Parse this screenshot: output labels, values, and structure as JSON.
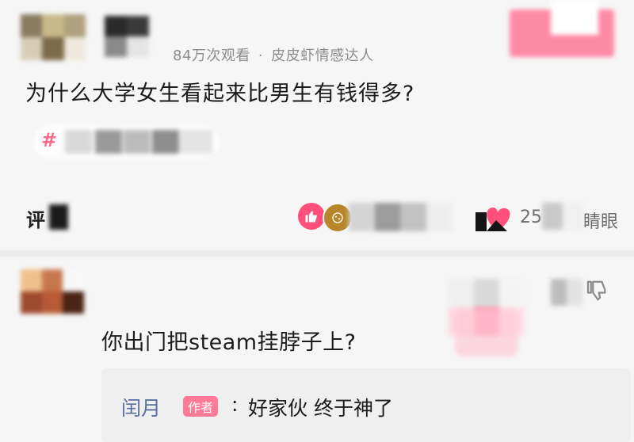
{
  "post": {
    "views": "84万次观看",
    "separator": "·",
    "category": "皮皮虾情感达人",
    "question": "为什么大学女生看起来比男生有钱得多?",
    "topic_hash": "#"
  },
  "action_bar": {
    "comment_label": "评",
    "like_count": "1",
    "fav_count": "25",
    "fav_suffix": "睛眼"
  },
  "comment": {
    "text": "你出门把steam挂脖子上?",
    "reply": {
      "name": "闰月",
      "badge": "作者",
      "colon": ":",
      "text": "好家伙 终于神了"
    }
  },
  "icons": {
    "like": "thumb-up-icon",
    "coin": "coin-icon",
    "heart": "heart-icon",
    "dislike": "thumb-down-icon"
  },
  "colors": {
    "accent_pink": "#ff4f7b",
    "badge_pink": "#ff7a96",
    "reply_name_blue": "#5a6ea0",
    "meta_gray": "#8c8c8c"
  }
}
